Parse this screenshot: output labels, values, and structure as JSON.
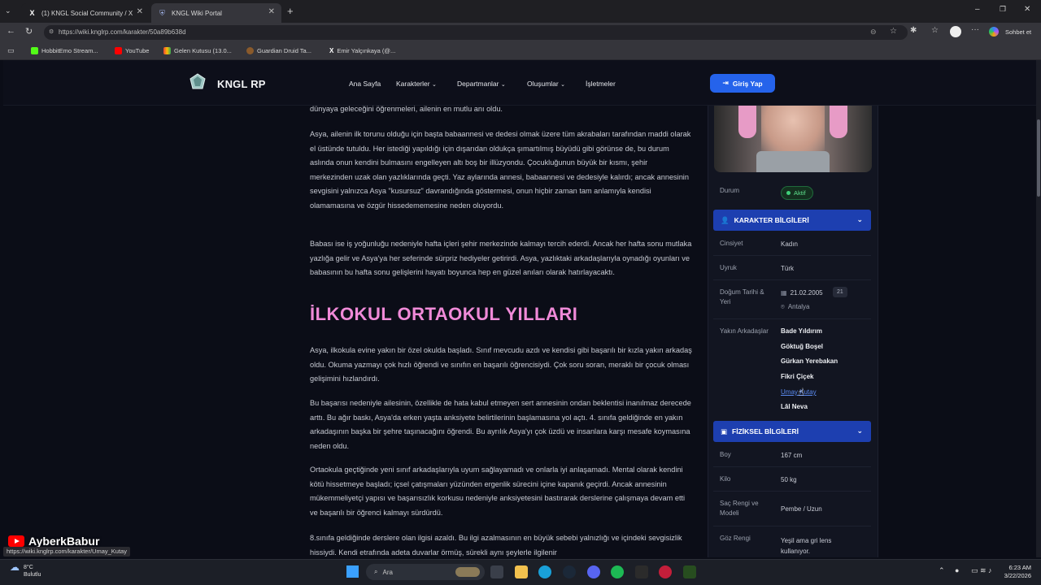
{
  "browser": {
    "tabs": [
      {
        "label": "(1) KNGL Social Community / X",
        "active": false
      },
      {
        "label": "KNGL Wiki Portal",
        "active": true
      }
    ],
    "url": "https://wiki.knglrp.com/karakter/50a89b638d",
    "profile_label": "Sohbet et",
    "bookmarks": [
      "HobbitEmo Stream...",
      "YouTube",
      "Gelen Kutusu (13.0...",
      "Guardian Druid Ta...",
      "Emir Yalçınkaya (@..."
    ]
  },
  "site": {
    "brand": "KNGL RP",
    "nav": [
      "Ana Sayfa",
      "Karakterler",
      "Departmanlar",
      "Oluşumlar",
      "İşletmeler"
    ],
    "login_label": "Giriş Yap"
  },
  "article": {
    "p0": "dünyaya geleceğini öğrenmeleri, ailenin en mutlu anı oldu.",
    "p1": "Asya, ailenin ilk torunu olduğu için başta babaannesi ve dedesi olmak üzere tüm akrabaları tarafından maddi olarak el üstünde tutuldu. Her istediği yapıldığı için dışarıdan oldukça şımartılmış büyüdü gibi görünse de, bu durum aslında onun kendini bulmasını engelleyen altı boş bir illüzyondu. Çocukluğunun büyük bir kısmı, şehir merkezinden uzak olan yazlıklarında geçti. Yaz aylarında annesi, babaannesi ve dedesiyle kalırdı; ancak annesinin sevgisini yalnızca Asya \"kusursuz\" davrandığında göstermesi, onun hiçbir zaman tam anlamıyla kendisi olamamasına ve özgür hissedememesine neden oluyordu.",
    "p2": "Babası ise iş yoğunluğu nedeniyle hafta içleri şehir merkezinde kalmayı tercih ederdi. Ancak her hafta sonu mutlaka yazlığa gelir ve Asya'ya her seferinde sürpriz hediyeler getirirdi. Asya, yazlıktaki arkadaşlarıyla oynadığı oyunları ve babasının bu hafta sonu gelişlerini hayatı boyunca hep en güzel anıları olarak hatırlayacaktı.",
    "heading": "İLKOKUL ORTAOKUL YILLARI",
    "p3": "Asya, ilkokula evine yakın bir özel okulda başladı. Sınıf mevcudu azdı ve kendisi gibi başarılı bir kızla yakın arkadaş oldu. Okuma yazmayı çok hızlı öğrendi ve sınıfın en başarılı öğrencisiydi. Çok soru soran, meraklı bir çocuk olması gelişimini hızlandırdı.",
    "p4": "Bu başarısı nedeniyle ailesinin, özellikle de hata kabul etmeyen sert annesinin ondan beklentisi inanılmaz derecede arttı. Bu ağır baskı, Asya'da erken yaşta anksiyete belirtilerinin başlamasına yol açtı. 4. sınıfa geldiğinde en yakın arkadaşının başka bir şehre taşınacağını öğrendi. Bu ayrılık Asya'yı çok üzdü ve insanlara karşı mesafe koymasına neden oldu.",
    "p5": "Ortaokula geçtiğinde yeni sınıf arkadaşlarıyla uyum sağlayamadı ve onlarla iyi anlaşamadı. Mental olarak kendini kötü hissetmeye başladı; içsel çatışmaları yüzünden ergenlik sürecini içine kapanık geçirdi. Ancak annesinin mükemmeliyetçi yapısı ve başarısızlık korkusu nedeniyle anksiyetesini bastırarak derslerine çalışmaya devam etti ve başarılı bir öğrenci kalmayı sürdürdü.",
    "p6": "8.sınıfa geldiğinde derslere olan ilgisi azaldı. Bu ilgi azalmasının en büyük sebebi yalnızlığı ve içindeki sevgisizlik hissiydi. Kendi etrafında adeta duvarlar örmüş, sürekli aynı şeylerle ilgilenir"
  },
  "sidebar": {
    "status_label": "Durum",
    "status_value": "Aktif",
    "character_header": "KARAKTER BİLGİLERİ",
    "gender_label": "Cinsiyet",
    "gender_value": "Kadın",
    "race_label": "Uyruk",
    "race_value": "Türk",
    "birth_label": "Doğum Tarihi & Yeri",
    "birth_date": "21.02.2005",
    "age": "21",
    "birth_place": "Antalya",
    "friends_label": "Yakın Arkadaşlar",
    "friends": [
      "Bade Yıldırım",
      "Göktuğ Boşel",
      "Gürkan Yerebakan",
      "Fikri Çiçek",
      "Umay Kutay",
      "Lâl Neva"
    ],
    "physical_header": "FİZİKSEL BİLGİLERİ",
    "height_label": "Boy",
    "height_value": "167 cm",
    "weight_label": "Kilo",
    "weight_value": "50 kg",
    "hair_label": "Saç Rengi ve Modeli",
    "hair_value": "Pembe / Uzun",
    "eye_label": "Göz Rengi",
    "eye_value": "Yeşil ama gri lens kullanıyor."
  },
  "overlay": {
    "hover_url": "https://wiki.knglrp.com/karakter/Umay_Kutay",
    "watermark": "AyberkBabur"
  },
  "taskbar": {
    "weather_temp": "8°C",
    "weather_desc": "Bulutlu",
    "search_placeholder": "Ara",
    "time": "6:23 AM",
    "date": "3/22/2026"
  },
  "colors": {
    "accent": "#2563eb",
    "panel_header": "#1d3fb0",
    "heading_pink": "#f08ad8",
    "status_green": "#3fd07a"
  }
}
